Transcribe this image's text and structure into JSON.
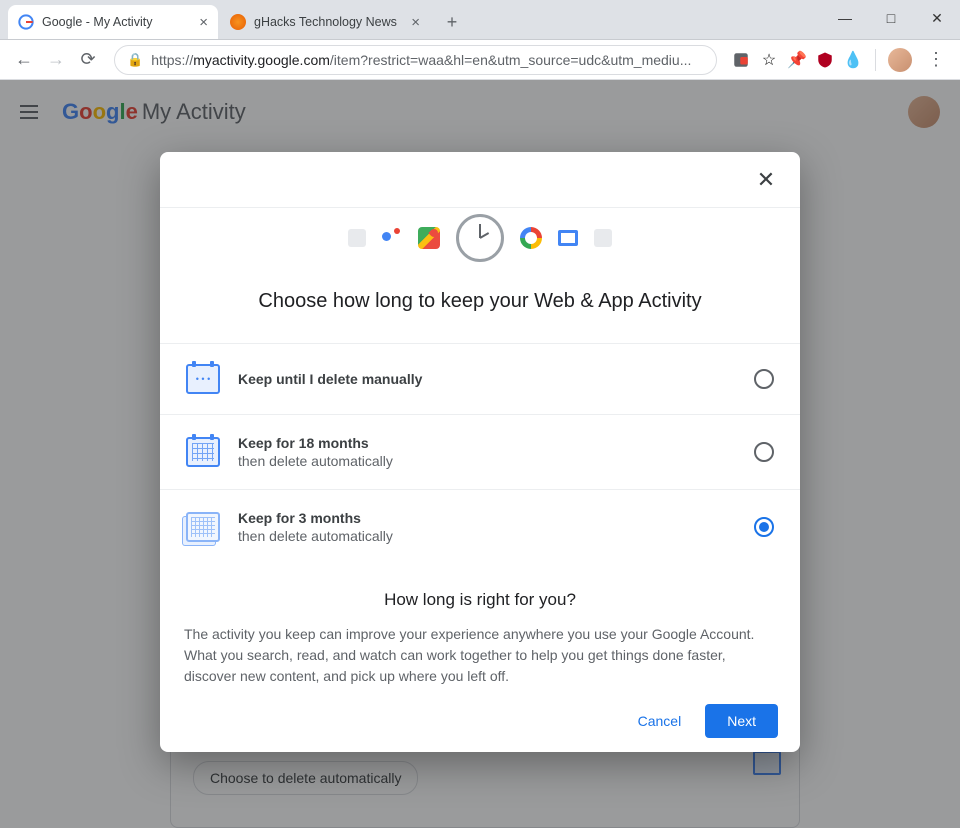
{
  "window": {
    "controls": {
      "min": "—",
      "max": "□",
      "close": "✕"
    }
  },
  "tabs": [
    {
      "title": "Google - My Activity",
      "active": true
    },
    {
      "title": "gHacks Technology News",
      "active": false
    }
  ],
  "omnibox": {
    "scheme": "https://",
    "host": "myactivity.google.com",
    "path": "/item?restrict=waa&hl=en&utm_source=udc&utm_mediu..."
  },
  "page": {
    "brand_logo": "Google",
    "brand_sub": "My Activity",
    "bg_button": "Choose to delete automatically"
  },
  "dialog": {
    "title": "Choose how long to keep your Web & App Activity",
    "options": [
      {
        "label": "Keep until I delete manually",
        "sub": "",
        "selected": false
      },
      {
        "label": "Keep for 18 months",
        "sub": "then delete automatically",
        "selected": false
      },
      {
        "label": "Keep for 3 months",
        "sub": "then delete automatically",
        "selected": true
      }
    ],
    "info_title": "How long is right for you?",
    "info_body": "The activity you keep can improve your experience anywhere you use your Google Account. What you search, read, and watch can work together to help you get things done faster, discover new content, and pick up where you left off.",
    "cancel": "Cancel",
    "next": "Next"
  }
}
